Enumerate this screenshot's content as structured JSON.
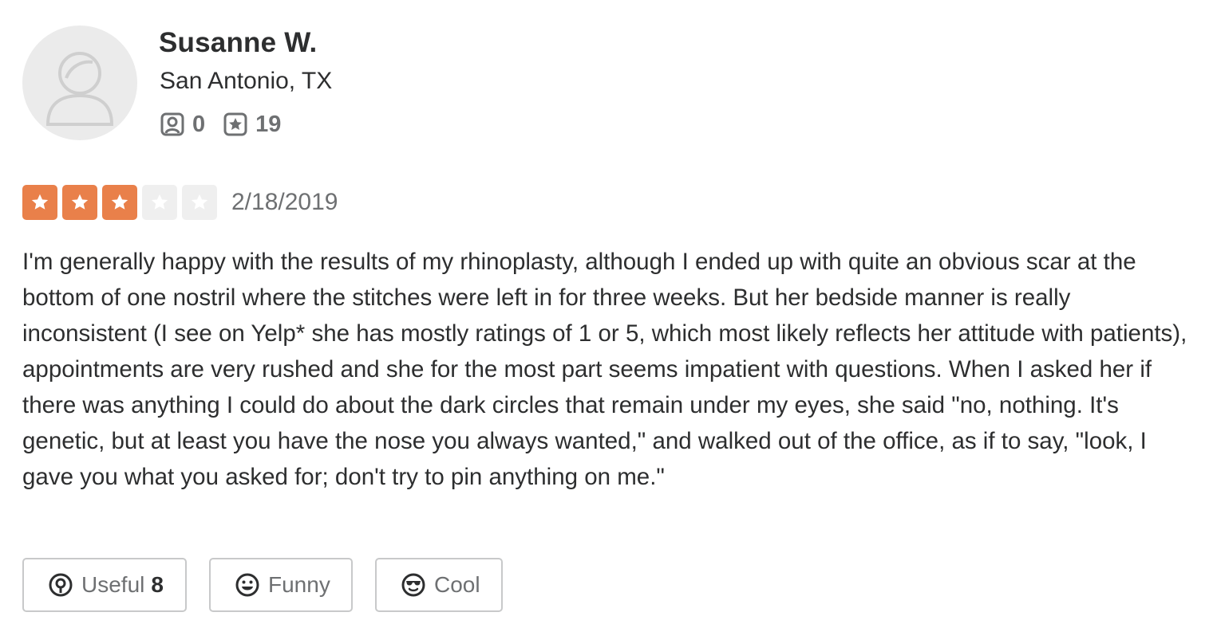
{
  "user": {
    "name": "Susanne W.",
    "location": "San Antonio, TX",
    "friends_count": "0",
    "reviews_count": "19",
    "avatar_icon": "default-avatar-icon"
  },
  "review": {
    "rating": 3,
    "max_rating": 5,
    "date": "2/18/2019",
    "text": "I'm generally happy with the results of my rhinoplasty, although I ended up with quite an obvious scar at the bottom of one nostril where the stitches were left in for three weeks. But her bedside manner is really inconsistent (I see on Yelp* she has mostly ratings of 1 or 5, which most likely reflects her attitude with patients), appointments are very rushed and she for the most part seems impatient with questions. When I asked her if there was anything I could do about the dark circles that remain under my eyes, she said \"no, nothing. It's genetic, but at least you have the nose you always wanted,\" and walked out of the office, as if to say, \"look, I gave you what you asked for; don't try to pin anything on me.\""
  },
  "actions": {
    "useful_label": "Useful",
    "useful_count": "8",
    "funny_label": "Funny",
    "cool_label": "Cool"
  },
  "colors": {
    "star_filled": "#e9804a",
    "star_empty": "#efefef",
    "text": "#2d2e2f",
    "muted": "#6e7072"
  }
}
